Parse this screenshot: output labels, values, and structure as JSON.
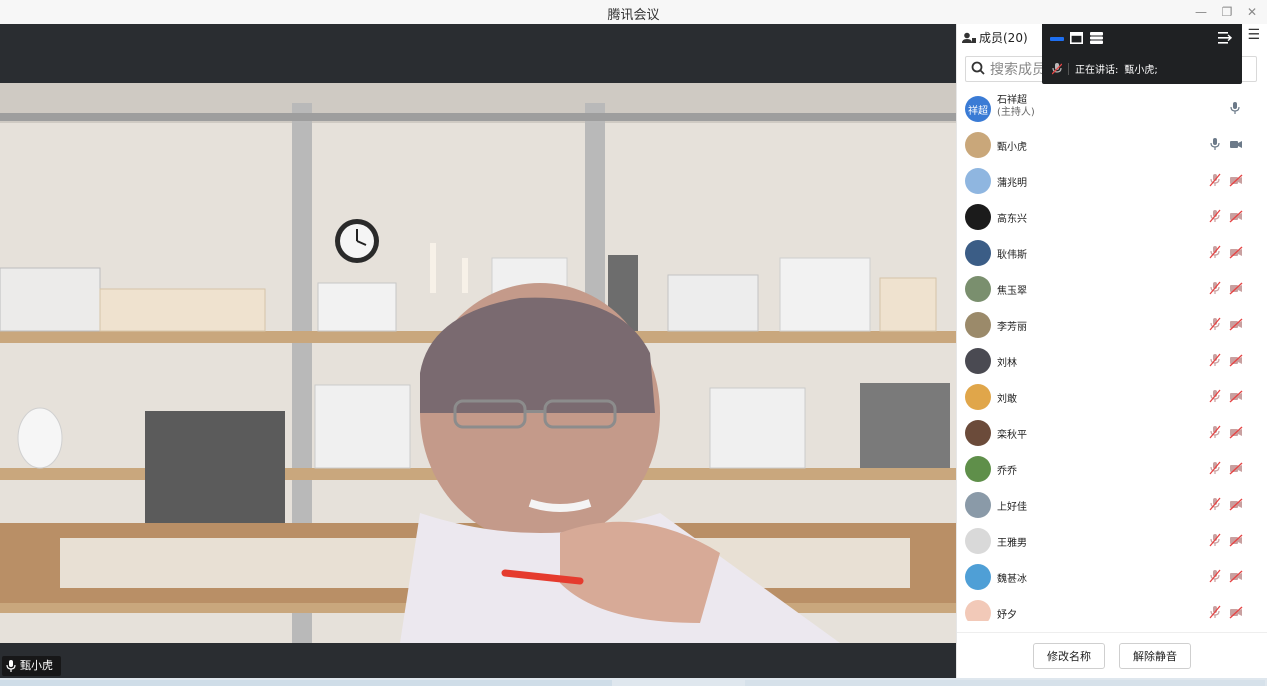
{
  "window": {
    "title": "腾讯会议",
    "minimize_symbol": "—",
    "restore_symbol": "❐",
    "close_symbol": "✕"
  },
  "video": {
    "active_speaker_label": "甄小虎"
  },
  "floating_bar": {
    "speaking_prefix": "正在讲话:",
    "speaking_name": "甄小虎;"
  },
  "panel": {
    "members_title": "成员(20)",
    "search_placeholder": "搜索成员",
    "members": [
      {
        "name": "石祥超",
        "role": "(主持人)",
        "avatar_text": "祥超",
        "avatar_color": "#3a7bd5",
        "mic": "on",
        "camera": "none"
      },
      {
        "name": "甄小虎",
        "role": "",
        "avatar_text": "",
        "avatar_color": "#c9a77a",
        "mic": "on",
        "camera": "on"
      },
      {
        "name": "蒲兆明",
        "role": "",
        "avatar_text": "",
        "avatar_color": "#8fb6e0",
        "mic": "muted",
        "camera": "off"
      },
      {
        "name": "高东兴",
        "role": "",
        "avatar_text": "",
        "avatar_color": "#1b1b1b",
        "mic": "muted",
        "camera": "off"
      },
      {
        "name": "耿伟斯",
        "role": "",
        "avatar_text": "",
        "avatar_color": "#3b5d86",
        "mic": "muted",
        "camera": "off"
      },
      {
        "name": "焦玉翠",
        "role": "",
        "avatar_text": "",
        "avatar_color": "#7a8f6e",
        "mic": "muted",
        "camera": "off"
      },
      {
        "name": "李芳丽",
        "role": "",
        "avatar_text": "",
        "avatar_color": "#9b8a6a",
        "mic": "muted",
        "camera": "off"
      },
      {
        "name": "刘林",
        "role": "",
        "avatar_text": "",
        "avatar_color": "#4a4a52",
        "mic": "muted",
        "camera": "off"
      },
      {
        "name": "刘敢",
        "role": "",
        "avatar_text": "",
        "avatar_color": "#e0a64a",
        "mic": "muted",
        "camera": "off"
      },
      {
        "name": "栾秋平",
        "role": "",
        "avatar_text": "",
        "avatar_color": "#6b4b3a",
        "mic": "muted",
        "camera": "off"
      },
      {
        "name": "乔乔",
        "role": "",
        "avatar_text": "",
        "avatar_color": "#5f8f4a",
        "mic": "muted",
        "camera": "off"
      },
      {
        "name": "上好佳",
        "role": "",
        "avatar_text": "",
        "avatar_color": "#8a9aa8",
        "mic": "muted",
        "camera": "off"
      },
      {
        "name": "王雅男",
        "role": "",
        "avatar_text": "",
        "avatar_color": "#d9d9d9",
        "mic": "muted",
        "camera": "off"
      },
      {
        "name": "魏甚冰",
        "role": "",
        "avatar_text": "",
        "avatar_color": "#4f9fd6",
        "mic": "muted",
        "camera": "off"
      },
      {
        "name": "妤夕",
        "role": "",
        "avatar_text": "",
        "avatar_color": "#f2c9b8",
        "mic": "muted",
        "camera": "off"
      }
    ],
    "rename_button": "修改名称",
    "unmute_button": "解除静音"
  },
  "colors": {
    "accent_blue": "#1e6ff1",
    "muted_red": "#e64545",
    "stage_bg": "#2a2d31"
  }
}
